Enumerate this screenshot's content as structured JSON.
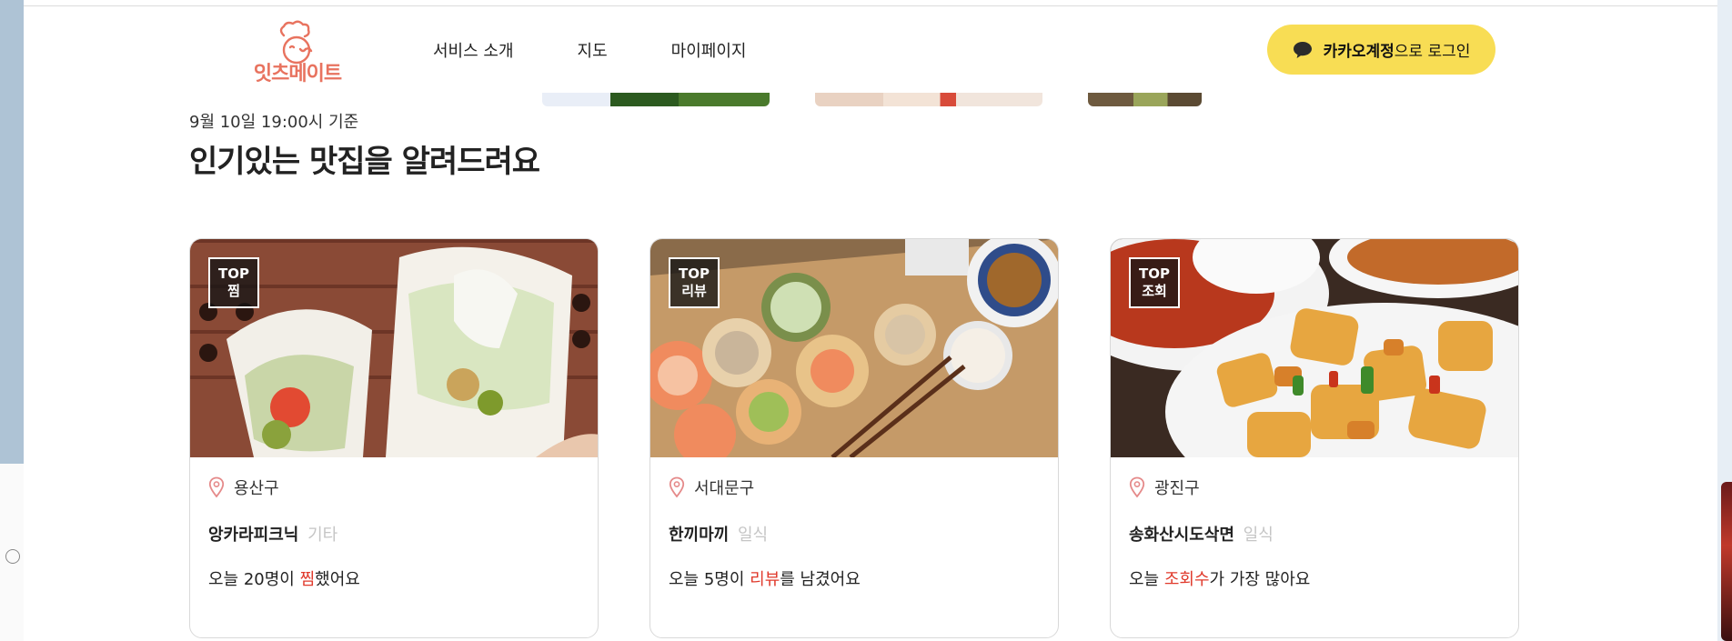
{
  "header": {
    "logo_text": "잇츠메이트",
    "nav": [
      "서비스 소개",
      "지도",
      "마이페이지"
    ],
    "login_bold": "카카오계정",
    "login_rest": "으로 로그인"
  },
  "section": {
    "subtitle": "9월 10일 19:00시 기준",
    "title": "인기있는 맛집을 알려드려요"
  },
  "cards": [
    {
      "badge_top": "TOP",
      "badge_sub": "찜",
      "district": "용산구",
      "name": "앙카라피크닉",
      "category": "기타",
      "stat_pre": "오늘 20명이 ",
      "stat_hl": "찜",
      "stat_post": "했어요"
    },
    {
      "badge_top": "TOP",
      "badge_sub": "리뷰",
      "district": "서대문구",
      "name": "한끼마끼",
      "category": "일식",
      "stat_pre": "오늘 5명이 ",
      "stat_hl": "리뷰",
      "stat_post": "를 남겼어요"
    },
    {
      "badge_top": "TOP",
      "badge_sub": "조회",
      "district": "광진구",
      "name": "송화산시도삭면",
      "category": "일식",
      "stat_pre": "오늘 ",
      "stat_hl": "조회수",
      "stat_post": "가 가장 많아요"
    }
  ],
  "colors": {
    "brand": "#e8735f",
    "kakao": "#f8dd54",
    "highlight": "#e0392b",
    "pin": "#e58a8a"
  },
  "icons": {
    "pin": "location-pin-icon",
    "chat": "kakao-chat-icon"
  }
}
